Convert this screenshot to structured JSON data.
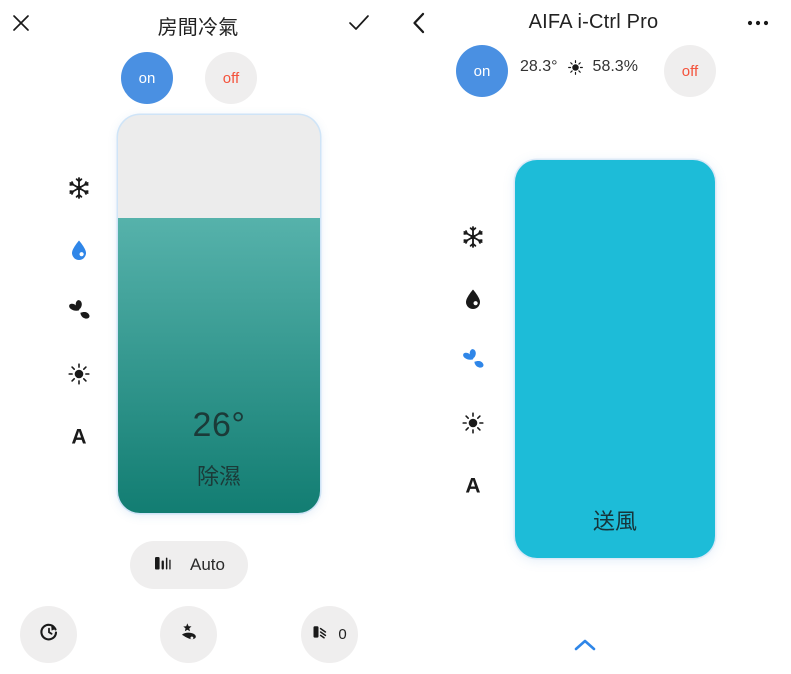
{
  "left_panel": {
    "header": {
      "close_icon": "close-icon",
      "title": "房間冷氣",
      "confirm_icon": "check-icon"
    },
    "power": {
      "on_label": "on",
      "off_label": "off",
      "selected": "on"
    },
    "modes": [
      {
        "icon": "snowflake-icon",
        "name": "cool",
        "active": false
      },
      {
        "icon": "water-drop-icon",
        "name": "dehumidify",
        "active": true
      },
      {
        "icon": "fan-icon",
        "name": "fan",
        "active": false
      },
      {
        "icon": "sun-icon",
        "name": "heat",
        "active": false
      },
      {
        "icon": "letter-a-icon",
        "name": "auto",
        "active": false
      }
    ],
    "slider": {
      "temperature": "26°",
      "mode_label": "除濕",
      "fill_percent": 74,
      "track_color": "#ececec",
      "fill_top_color": "#56b2ab",
      "fill_bottom_color": "#127d72"
    },
    "fan_speed": {
      "icon": "fan-bars-icon",
      "label": "Auto"
    },
    "bottom_buttons": [
      {
        "icon": "timer-icon",
        "name": "timer",
        "label": ""
      },
      {
        "icon": "sleep-icon",
        "name": "sleep-mode",
        "label": ""
      },
      {
        "icon": "fan-swing-icon",
        "name": "swing",
        "label": "0"
      }
    ]
  },
  "right_panel": {
    "header": {
      "back_icon": "chevron-left-icon",
      "title": "AIFA i-Ctrl Pro",
      "more_icon": "more-horizontal-icon"
    },
    "power": {
      "on_label": "on",
      "off_label": "off",
      "selected": "on"
    },
    "readings": {
      "temperature": "28.3°",
      "sensor_icon": "sun-icon",
      "humidity": "58.3%"
    },
    "modes": [
      {
        "icon": "snowflake-icon",
        "name": "cool",
        "active": false
      },
      {
        "icon": "water-drop-icon",
        "name": "dehumidify",
        "active": false
      },
      {
        "icon": "fan-icon",
        "name": "fan",
        "active": true
      },
      {
        "icon": "sun-icon",
        "name": "heat",
        "active": false
      },
      {
        "icon": "letter-a-icon",
        "name": "auto",
        "active": false
      }
    ],
    "card": {
      "mode_label": "送風",
      "color": "#1dbcd8"
    },
    "expand_icon": "chevron-up-icon"
  },
  "colors": {
    "accent_blue": "#4a90e2",
    "off_red": "#f4523b",
    "cyan_card": "#1dbcd8",
    "teal_top": "#56b2ab",
    "teal_bottom": "#127d72",
    "chip_gray": "#efeeee"
  }
}
